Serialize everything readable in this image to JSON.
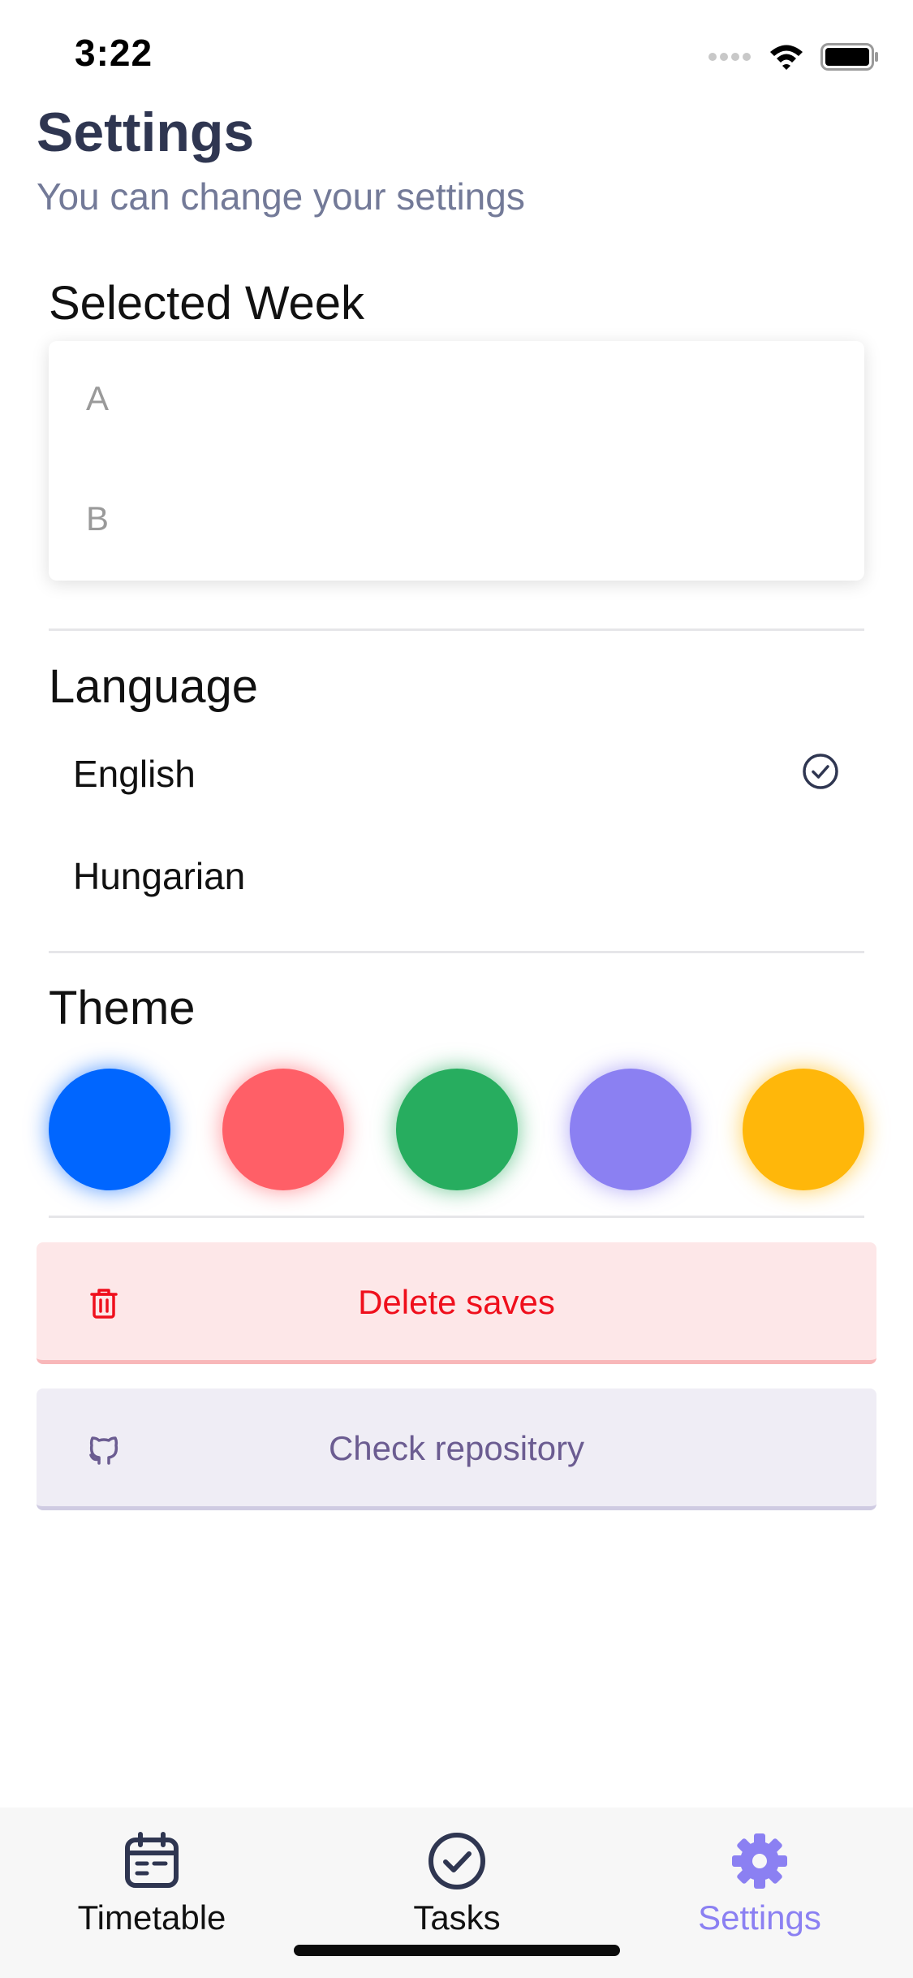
{
  "status_bar": {
    "time": "3:22"
  },
  "header": {
    "title": "Settings",
    "subtitle": "You can change your settings"
  },
  "selected_week": {
    "heading": "Selected Week",
    "options": [
      "A",
      "B"
    ]
  },
  "language": {
    "heading": "Language",
    "options": [
      {
        "label": "English",
        "selected": true
      },
      {
        "label": "Hungarian",
        "selected": false
      }
    ]
  },
  "theme": {
    "heading": "Theme",
    "colors": [
      "#0066ff",
      "#ff5f67",
      "#27ad5f",
      "#8b80f2",
      "#ffb70a"
    ]
  },
  "actions": {
    "delete_label": "Delete saves",
    "repo_label": "Check repository"
  },
  "tabs": [
    {
      "label": "Timetable",
      "icon": "calendar-icon",
      "active": false
    },
    {
      "label": "Tasks",
      "icon": "check-circle-icon",
      "active": false
    },
    {
      "label": "Settings",
      "icon": "gear-icon",
      "active": true
    }
  ],
  "colors": {
    "title": "#2f3651",
    "subtitle": "#737a98",
    "tab_active": "#8b80f2",
    "tab_inactive": "#2f3651",
    "delete_text": "#ef0f1c",
    "repo_text": "#6b5c91"
  }
}
